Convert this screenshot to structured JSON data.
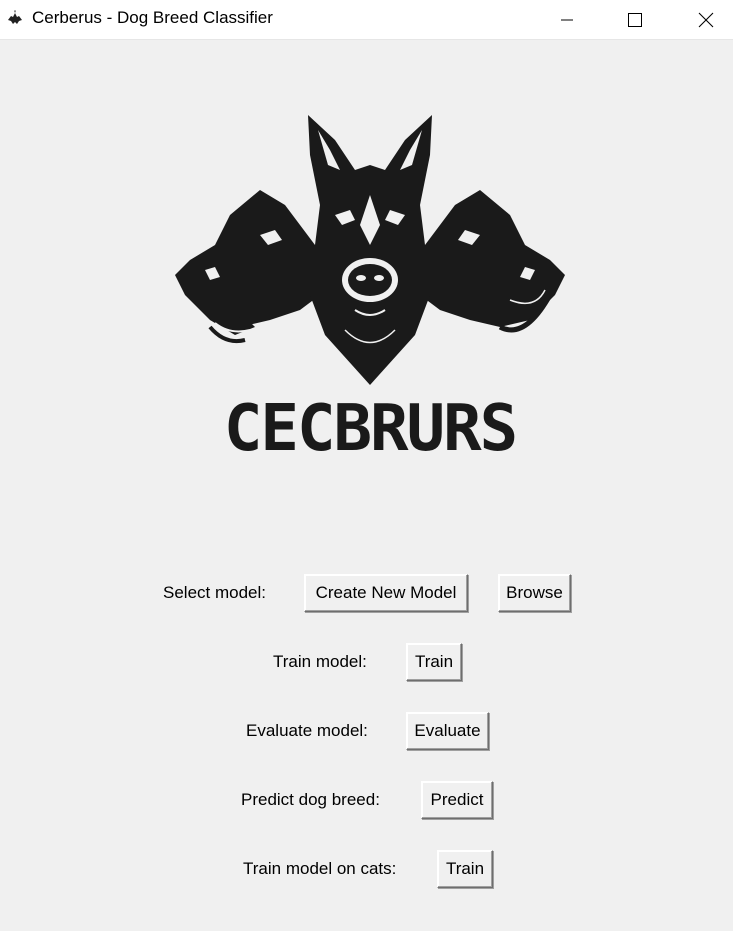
{
  "window": {
    "title": "Cerberus - Dog Breed Classifier",
    "app_icon": "cerberus-icon",
    "controls": [
      "minimize-icon",
      "maximize-icon",
      "close-icon"
    ]
  },
  "logo": {
    "text": "CECBRURS",
    "image": "three-headed-dog-logo"
  },
  "rows": {
    "select_model": {
      "label": "Select model:",
      "create_button": "Create New Model",
      "browse_button": "Browse"
    },
    "train_model": {
      "label": "Train model:",
      "button": "Train"
    },
    "evaluate_model": {
      "label": "Evaluate model:",
      "button": "Evaluate"
    },
    "predict": {
      "label": "Predict dog breed:",
      "button": "Predict"
    },
    "train_cats": {
      "label": "Train model on cats:",
      "button": "Train"
    }
  },
  "colors": {
    "background": "#f0f0f0",
    "titlebar": "#ffffff",
    "logo": "#1a1a1a"
  }
}
